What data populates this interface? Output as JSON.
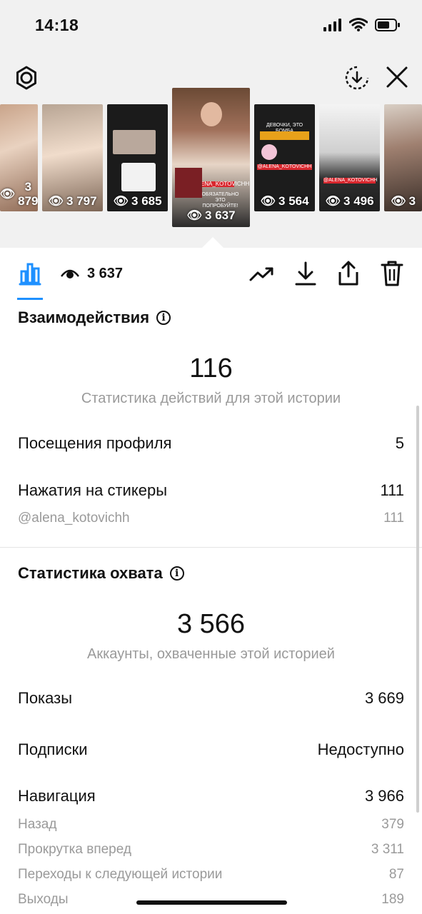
{
  "status_bar": {
    "time": "14:18"
  },
  "stories": [
    {
      "views": "3 879"
    },
    {
      "views": "3 797"
    },
    {
      "views": "3 685"
    },
    {
      "views": "3 637",
      "caption": "ОБЯЗАТЕЛЬНО ЭТО ПОПРОБУЙТЕ!",
      "tag": "@ALENA_KOTOVICHH"
    },
    {
      "views": "3 564",
      "caption": "ДЕВОЧКИ, ЭТО БОМБА",
      "tag": "@ALENA_KOTOVICHH"
    },
    {
      "views": "3 496",
      "tag": "@ALENA_KOTOVICHH"
    },
    {
      "views": "3"
    }
  ],
  "toolbar": {
    "views": "3 637"
  },
  "interactions": {
    "title": "Взаимодействия",
    "total": "116",
    "caption": "Статистика действий для этой истории",
    "profile_visits_label": "Посещения профиля",
    "profile_visits_value": "5",
    "sticker_taps_label": "Нажатия на стикеры",
    "sticker_taps_value": "111",
    "sticker_handle": "@alena_kotovichh",
    "sticker_handle_value": "111"
  },
  "reach": {
    "title": "Статистика охвата",
    "total": "3 566",
    "caption": "Аккаунты, охваченные этой историей",
    "impressions_label": "Показы",
    "impressions_value": "3 669",
    "follows_label": "Подписки",
    "follows_value": "Недоступно",
    "navigation_label": "Навигация",
    "navigation_value": "3 966",
    "back_label": "Назад",
    "back_value": "379",
    "forward_label": "Прокрутка вперед",
    "forward_value": "3 311",
    "next_story_label": "Переходы к следующей истории",
    "next_story_value": "87",
    "exits_label": "Выходы",
    "exits_value": "189"
  }
}
